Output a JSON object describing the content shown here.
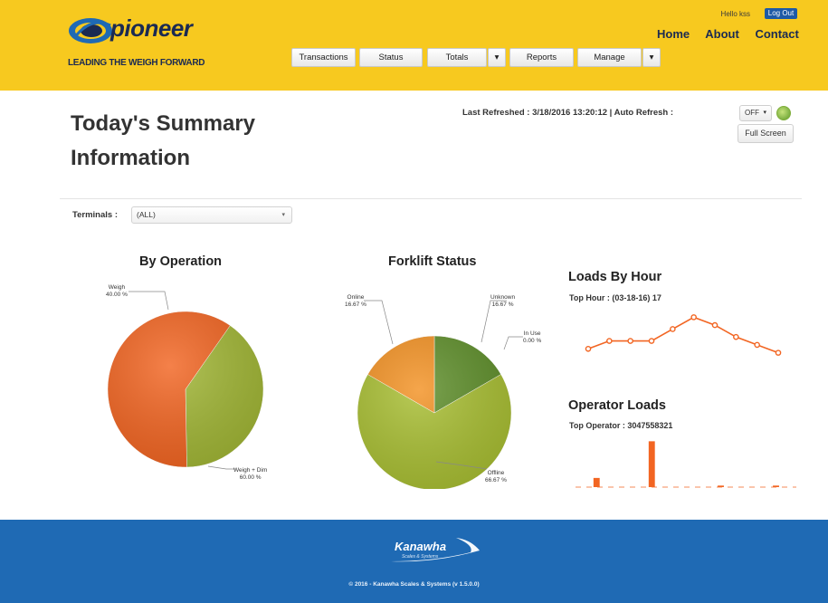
{
  "header": {
    "logo_text": "pioneer",
    "tagline": "LEADING THE WEIGH FORWARD",
    "greeting": "Hello kss",
    "logout_label": "Log Out",
    "nav": [
      "Home",
      "About",
      "Contact"
    ],
    "menu": {
      "transactions": "Transactions",
      "status": "Status",
      "totals": "Totals",
      "reports": "Reports",
      "manage": "Manage",
      "dropdown_caret": "▾"
    },
    "colors": {
      "bar": "#f7c91f",
      "logout": "#1d5aa6"
    }
  },
  "main": {
    "title_line1": "Today's Summary",
    "title_line2": "Information",
    "refresh_text": "Last Refreshed : 3/18/2016 13:20:12 | Auto Refresh :",
    "auto_refresh_value": "OFF",
    "refresh_icon": "refresh-icon",
    "fullscreen_label": "Full Screen",
    "terminals_label": "Terminals :",
    "terminals_value": "(ALL)"
  },
  "chart_data": [
    {
      "type": "pie",
      "title": "By Operation",
      "labels": [
        "Weigh",
        "Weigh + Dim"
      ],
      "values": [
        40.0,
        60.0
      ],
      "value_labels": [
        "40.00 %",
        "60.00 %"
      ],
      "colors": [
        "#a2b736",
        "#f26522"
      ]
    },
    {
      "type": "pie",
      "title": "Forklift Status",
      "labels": [
        "Unknown",
        "In Use",
        "Offline",
        "Online"
      ],
      "values": [
        16.67,
        0.0,
        66.67,
        16.67
      ],
      "value_labels": [
        "16.67 %",
        "0.00 %",
        "66.67 %",
        "16.67 %"
      ],
      "colors": [
        "#5f8f2b",
        "#5f8f2b",
        "#a9bf33",
        "#f39224"
      ]
    },
    {
      "type": "line",
      "title": "Loads By Hour",
      "subtitle": "Top Hour : (03-18-16) 17",
      "x": [
        12,
        13,
        14,
        15,
        16,
        17,
        18,
        19,
        20,
        21
      ],
      "values": [
        2,
        4,
        4,
        4,
        7,
        10,
        8,
        5,
        3,
        1
      ],
      "ylim": [
        0,
        11
      ],
      "color": "#f26522"
    },
    {
      "type": "bar",
      "title": "Operator Loads",
      "subtitle": "Top Operator : 3047558321",
      "values": [
        0,
        6,
        0,
        0,
        0,
        30,
        0,
        0,
        0,
        0,
        1,
        0,
        0,
        0,
        1,
        0
      ],
      "ylim": [
        0,
        32
      ],
      "color": "#f26522"
    }
  ],
  "footer": {
    "brand": "Kanawha",
    "brand_sub": "Scales & Systems",
    "copyright": "© 2016 - Kanawha Scales & Systems (v 1.5.0.0)",
    "color": "#1f6ab4"
  }
}
